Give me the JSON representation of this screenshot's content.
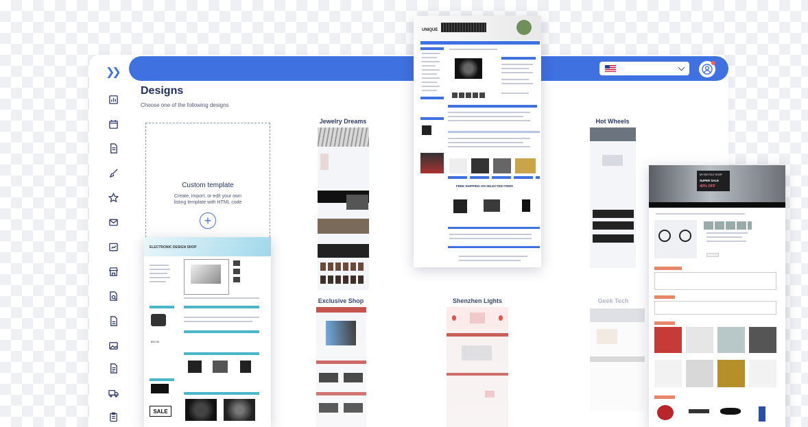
{
  "page": {
    "title": "Designs",
    "subtitle": "Choose one of the following designs"
  },
  "custom_template": {
    "title": "Custom template",
    "description": "Create, import, or edit your own listing template with HTML code"
  },
  "templates": [
    {
      "name": "Jewelry Dreams"
    },
    {
      "name": "Hot Wheels"
    },
    {
      "name": "Exclusive Shop"
    },
    {
      "name": "Shenzhen Lights"
    },
    {
      "name": "Geek Tech"
    }
  ],
  "previews": {
    "electronic": {
      "header": "ELECTRONIC DESIGN SHOP",
      "price": "$39.99",
      "sale": "SALE"
    },
    "unique": {
      "logo": "UNIQUE",
      "banner": "FREE SHIPPING ON SELECTED ITEMS"
    },
    "bicycle": {
      "line1": "MY BICYCLE SHOP",
      "line2": "SUPER SALE",
      "line3": "40% OFF"
    }
  },
  "icons": [
    "collapse-icon",
    "chart-icon",
    "calendar-icon",
    "document-icon",
    "brush-icon",
    "star-icon",
    "mail-icon",
    "report-icon",
    "store-icon",
    "search-doc-icon",
    "file-icon",
    "image-icon",
    "file-text-icon",
    "truck-icon",
    "clipboard-icon"
  ],
  "colors": {
    "primary": "#3f71e0",
    "title": "#1f2d5c",
    "accent_red": "#d9534f",
    "teal": "#4ab6c9"
  }
}
